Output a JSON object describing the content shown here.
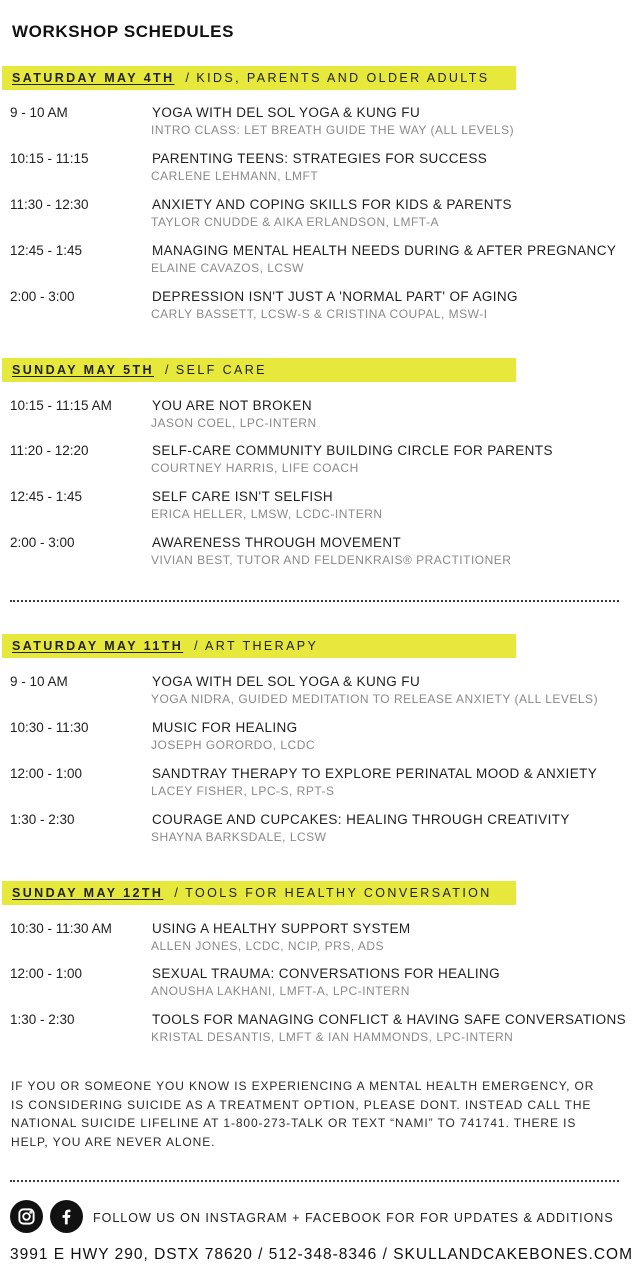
{
  "page_title": "WORKSHOP SCHEDULES",
  "sections": [
    {
      "day": "SATURDAY MAY 4TH",
      "separator": "/",
      "theme": "KIDS, PARENTS AND OLDER ADULTS",
      "items": [
        {
          "time": "9 - 10 AM",
          "title": "YOGA WITH DEL SOL YOGA & KUNG FU",
          "presenter": "INTRO CLASS: LET BREATH GUIDE THE WAY (ALL LEVELS)"
        },
        {
          "time": "10:15 - 11:15",
          "title": "PARENTING TEENS: STRATEGIES FOR SUCCESS",
          "presenter": "CARLENE LEHMANN, LMFT"
        },
        {
          "time": "11:30 - 12:30",
          "title": "ANXIETY AND COPING SKILLS FOR KIDS & PARENTS",
          "presenter": "TAYLOR CNUDDE & AIKA ERLANDSON, LMFT-A"
        },
        {
          "time": "12:45 - 1:45",
          "title": "MANAGING MENTAL HEALTH NEEDS DURING & AFTER PREGNANCY",
          "presenter": "ELAINE CAVAZOS, LCSW"
        },
        {
          "time": "2:00 - 3:00",
          "title": "DEPRESSION ISN'T JUST A 'NORMAL PART' OF AGING",
          "presenter": "CARLY BASSETT, LCSW-S & CRISTINA COUPAL, MSW-I"
        }
      ]
    },
    {
      "day": "SUNDAY MAY 5TH",
      "separator": "/",
      "theme": "SELF CARE",
      "items": [
        {
          "time": "10:15 - 11:15 AM",
          "title": "YOU ARE NOT BROKEN",
          "presenter": "JASON COEL, LPC-INTERN"
        },
        {
          "time": "11:20 - 12:20",
          "title": "SELF-CARE COMMUNITY BUILDING CIRCLE FOR PARENTS",
          "presenter": "COURTNEY HARRIS, LIFE COACH"
        },
        {
          "time": "12:45 - 1:45",
          "title": "SELF CARE ISN'T SELFISH",
          "presenter": "ERICA HELLER, LMSW, LCDC-INTERN"
        },
        {
          "time": "2:00 - 3:00",
          "title": "AWARENESS THROUGH MOVEMENT",
          "presenter": "VIVIAN BEST, TUTOR AND FELDENKRAIS® PRACTITIONER"
        }
      ]
    },
    {
      "day": "SATURDAY MAY 11TH",
      "separator": "/",
      "theme": "ART THERAPY",
      "items": [
        {
          "time": "9 - 10 AM",
          "title": "YOGA WITH DEL SOL YOGA & KUNG FU",
          "presenter": "YOGA NIDRA, GUIDED MEDITATION TO RELEASE ANXIETY (ALL LEVELS)"
        },
        {
          "time": "10:30 - 11:30",
          "title": "MUSIC FOR HEALING",
          "presenter": "JOSEPH GORORDO, LCDC"
        },
        {
          "time": "12:00 - 1:00",
          "title": "SANDTRAY THERAPY TO EXPLORE PERINATAL MOOD & ANXIETY",
          "presenter": "LACEY FISHER, LPC-S, RPT-S"
        },
        {
          "time": "1:30 - 2:30",
          "title": "COURAGE AND CUPCAKES: HEALING THROUGH CREATIVITY",
          "presenter": "SHAYNA BARKSDALE, LCSW"
        }
      ]
    },
    {
      "day": "SUNDAY MAY 12TH",
      "separator": "/",
      "theme": "TOOLS FOR HEALTHY CONVERSATION",
      "items": [
        {
          "time": "10:30 - 11:30 AM",
          "title": "USING A HEALTHY SUPPORT SYSTEM",
          "presenter": "ALLEN JONES, LCDC, NCIP, PRS, ADS"
        },
        {
          "time": "12:00 - 1:00",
          "title": "SEXUAL TRAUMA: CONVERSATIONS FOR HEALING",
          "presenter": "ANOUSHA LAKHANI, LMFT-A, LPC-INTERN"
        },
        {
          "time": "1:30 - 2:30",
          "title": "TOOLS FOR MANAGING CONFLICT & HAVING SAFE CONVERSATIONS",
          "presenter": "KRISTAL DESANTIS, LMFT & IAN HAMMONDS, LPC-INTERN"
        }
      ]
    }
  ],
  "notice": "IF YOU OR SOMEONE YOU KNOW IS EXPERIENCING A MENTAL HEALTH EMERGENCY, OR IS CONSIDERING SUICIDE AS A TREATMENT OPTION, PLEASE DONT. INSTEAD CALL THE NATIONAL SUICIDE LIFELINE AT 1-800-273-TALK OR TEXT “NAMI” TO 741741. THERE IS HELP, YOU ARE NEVER ALONE.",
  "social": {
    "icons": [
      "instagram-icon",
      "facebook-icon"
    ],
    "follow_text": "FOLLOW US ON INSTAGRAM + FACEBOOK FOR FOR UPDATES & ADDITIONS"
  },
  "footer": "3991 E HWY 290, DSTX 78620 / 512-348-8346 / SKULLANDCAKEBONES.COM",
  "colors": {
    "highlight": "#e6e83c",
    "text": "#1f1f1f",
    "muted": "#8a8a8a",
    "icon_bg": "#111111"
  }
}
